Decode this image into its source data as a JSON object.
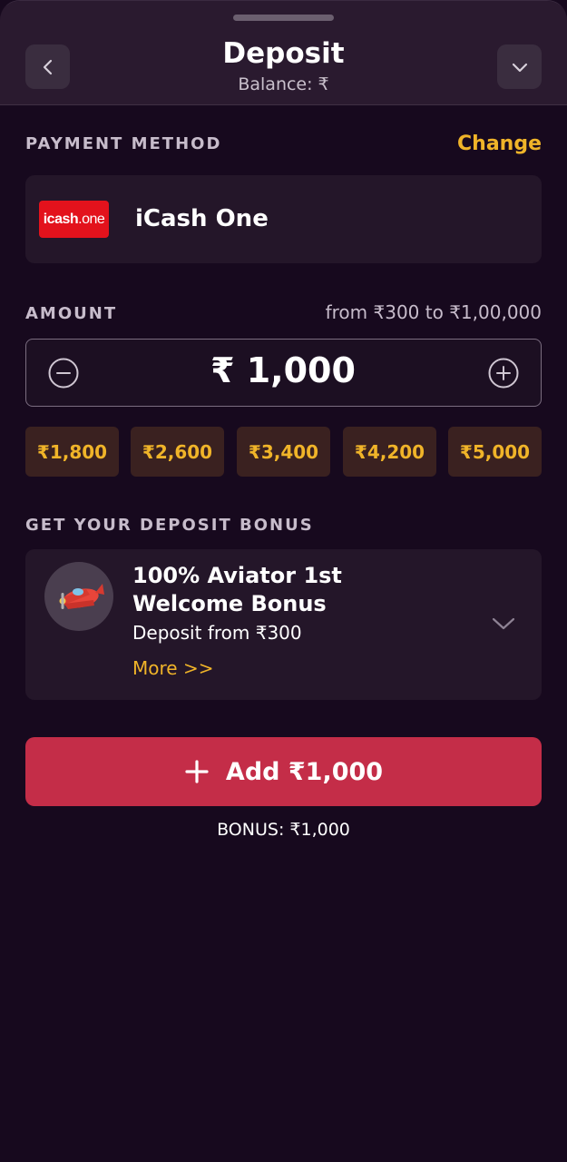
{
  "header": {
    "title": "Deposit",
    "balance": "Balance: ₹",
    "back_icon": "chevron-left-icon",
    "collapse_icon": "chevron-down-icon"
  },
  "payment": {
    "section_label": "PAYMENT METHOD",
    "change_label": "Change",
    "method_name": "iCash One",
    "logo_text_bold": "icash",
    "logo_text_thin": ".one"
  },
  "amount": {
    "section_label": "AMOUNT",
    "range": "from ₹300 to ₹1,00,000",
    "value": "₹ 1,000",
    "decrease_icon": "minus-circle-icon",
    "increase_icon": "plus-circle-icon",
    "presets": [
      "₹1,800",
      "₹2,600",
      "₹3,400",
      "₹4,200",
      "₹5,000"
    ]
  },
  "bonus": {
    "section_label": "GET YOUR DEPOSIT BONUS",
    "title": "100% Aviator 1st Welcome Bonus",
    "subtitle": "Deposit from ₹300",
    "more_label": "More >>",
    "icon": "plane-icon"
  },
  "action": {
    "add_label": "Add ₹1,000",
    "bonus_note": "BONUS: ₹1,000"
  },
  "colors": {
    "background": "#17091e",
    "header": "#2a1a2f",
    "card": "#241629",
    "accent": "#f0b429",
    "primary_button": "#c42d48",
    "chip": "#3a2120"
  }
}
